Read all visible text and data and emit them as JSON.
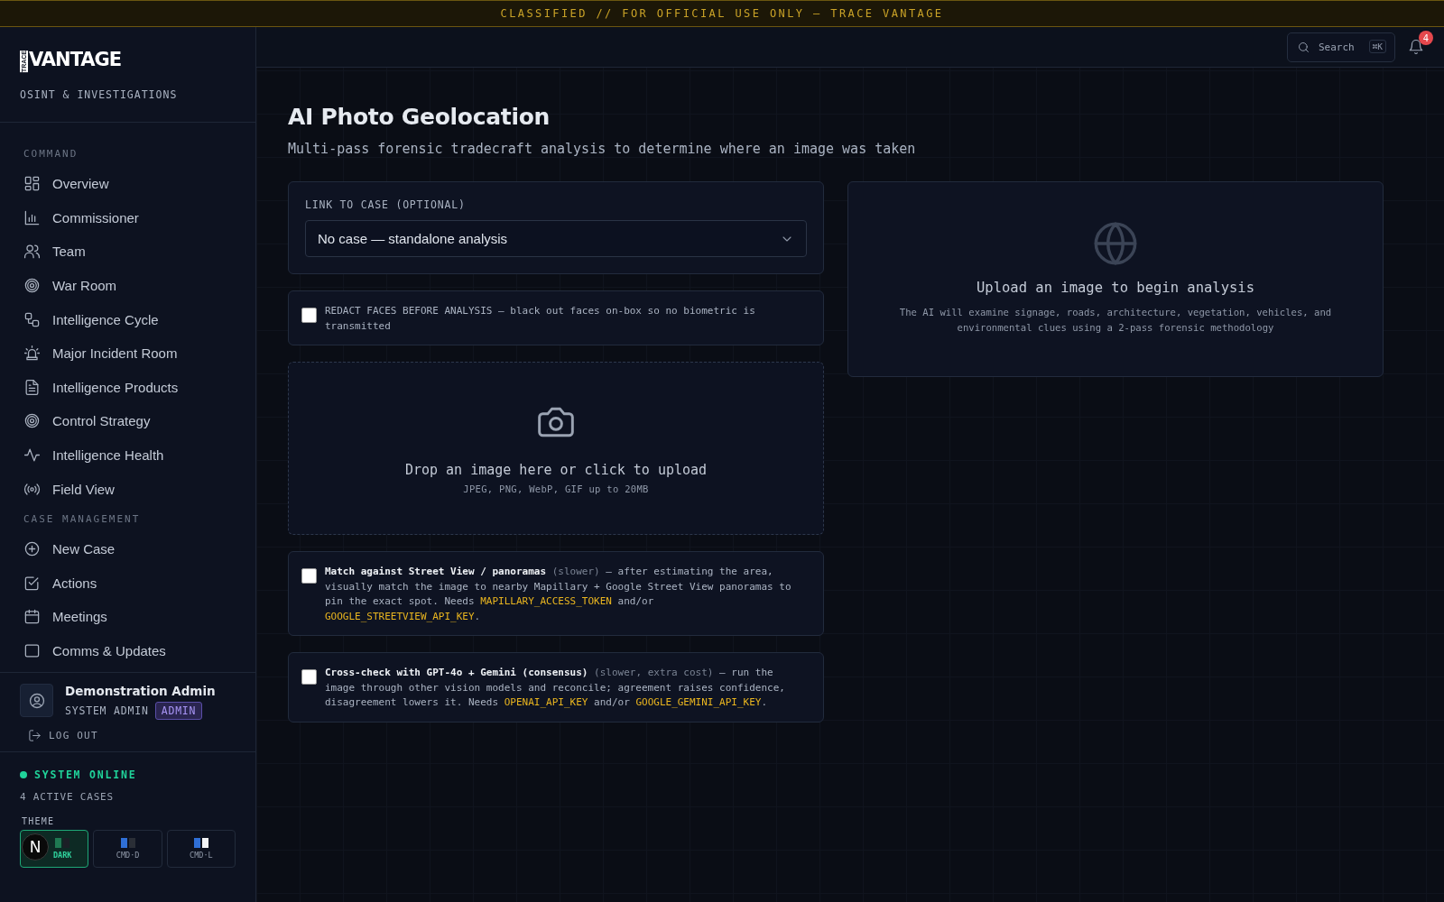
{
  "banner": "CLASSIFIED // FOR OFFICIAL USE ONLY — TRACE VANTAGE",
  "sidebar": {
    "logo": {
      "small": "TRACE",
      "big": "VANTAGE"
    },
    "tagline": "OSINT & INVESTIGATIONS",
    "sections": [
      {
        "label": "COMMAND",
        "items": [
          {
            "label": "Overview"
          },
          {
            "label": "Commissioner"
          },
          {
            "label": "Team"
          },
          {
            "label": "War Room"
          },
          {
            "label": "Intelligence Cycle"
          },
          {
            "label": "Major Incident Room"
          },
          {
            "label": "Intelligence Products"
          },
          {
            "label": "Control Strategy"
          },
          {
            "label": "Intelligence Health"
          },
          {
            "label": "Field View"
          }
        ]
      },
      {
        "label": "CASE MANAGEMENT",
        "items": [
          {
            "label": "New Case"
          },
          {
            "label": "Actions"
          },
          {
            "label": "Meetings"
          },
          {
            "label": "Comms & Updates"
          }
        ]
      }
    ],
    "user": {
      "name": "Demonstration Admin",
      "role": "SYSTEM ADMIN",
      "badge": "ADMIN"
    },
    "logout": "LOG OUT",
    "status": "SYSTEM ONLINE",
    "active_cases": "4 ACTIVE CASES",
    "theme_label": "THEME",
    "themes": [
      {
        "label": "DARK",
        "selected": true
      },
      {
        "label": "CMD·D",
        "selected": false
      },
      {
        "label": "CMD·L",
        "selected": false
      }
    ],
    "dev_badge": "N"
  },
  "header": {
    "search": {
      "placeholder": "Search",
      "shortcut": "⌘K"
    },
    "notifications": "4"
  },
  "page": {
    "title": "AI Photo Geolocation",
    "subtitle": "Multi-pass forensic tradecraft analysis to determine where an image was taken",
    "case_select": {
      "label": "LINK TO CASE (OPTIONAL)",
      "value": "No case — standalone analysis"
    },
    "options": [
      {
        "checked": false,
        "segments": [
          {
            "kind": "plain",
            "text": "REDACT FACES BEFORE ANALYSIS — black out faces on-box so no biometric is transmitted"
          }
        ]
      },
      {
        "kind": "dropzone",
        "title": "Drop an image here or click to upload",
        "hint": "JPEG, PNG, WebP, GIF up to 20MB"
      },
      {
        "checked": false,
        "segments": [
          {
            "kind": "strong",
            "text": "Match against Street View / panoramas"
          },
          {
            "kind": "muted",
            "text": " (slower)"
          },
          {
            "kind": "plain",
            "text": " — after estimating the area, visually match the image to nearby Mapillary + Google Street View panoramas to pin the exact spot. Needs "
          },
          {
            "kind": "key",
            "text": "MAPILLARY_ACCESS_TOKEN"
          },
          {
            "kind": "plain",
            "text": " and/or "
          },
          {
            "kind": "key",
            "text": "GOOGLE_STREETVIEW_API_KEY"
          },
          {
            "kind": "plain",
            "text": "."
          }
        ]
      },
      {
        "checked": false,
        "segments": [
          {
            "kind": "strong",
            "text": "Cross-check with GPT-4o + Gemini (consensus)"
          },
          {
            "kind": "muted",
            "text": " (slower, extra cost)"
          },
          {
            "kind": "plain",
            "text": " — run the image through other vision models and reconcile; agreement raises confidence, disagreement lowers it. Needs "
          },
          {
            "kind": "key",
            "text": "OPENAI_API_KEY"
          },
          {
            "kind": "plain",
            "text": " and/or "
          },
          {
            "kind": "key",
            "text": "GOOGLE_GEMINI_API_KEY"
          },
          {
            "kind": "plain",
            "text": "."
          }
        ]
      }
    ],
    "result": {
      "title": "Upload an image to begin analysis",
      "text": "The AI will examine signage, roads, architecture, vegetation, vehicles, and environmental clues using a 2-pass forensic methodology"
    }
  }
}
